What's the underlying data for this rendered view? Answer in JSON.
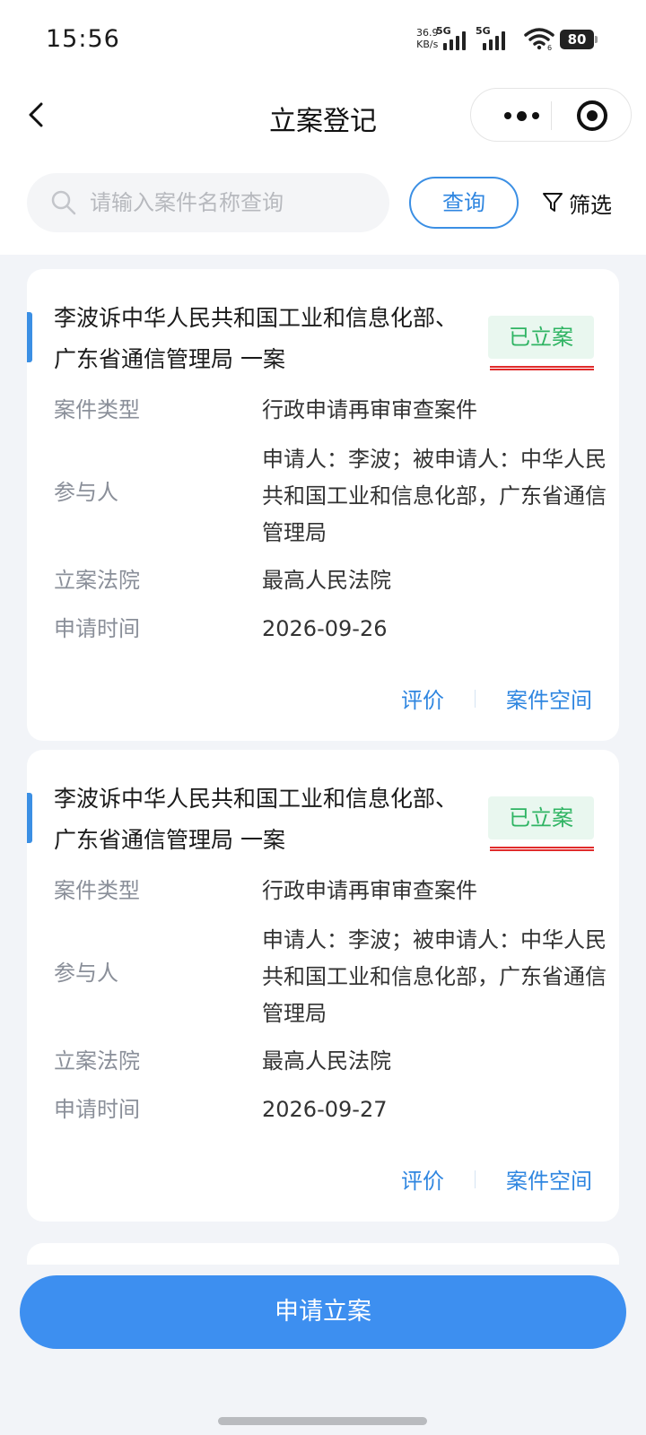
{
  "status_bar": {
    "time": "15:56",
    "net_speed_value": "36.9",
    "net_speed_unit": "KB/s",
    "sim1": "5G",
    "sim2": "5G",
    "wifi_sub": "6",
    "battery": "80"
  },
  "header": {
    "title": "立案登记"
  },
  "search": {
    "placeholder": "请输入案件名称查询",
    "value": "",
    "query_label": "查询",
    "filter_label": "筛选"
  },
  "cases": [
    {
      "title": "李波诉中华人民共和国工业和信息化部、广东省通信管理局 一案",
      "status": "已立案",
      "fields": [
        {
          "label": "案件类型",
          "value": "行政申请再审审查案件"
        },
        {
          "label": "参与人",
          "value": "申请人：李波；被申请人：中华人民共和国工业和信息化部，广东省通信管理局"
        },
        {
          "label": "立案法院",
          "value": "最高人民法院"
        },
        {
          "label": "申请时间",
          "value": "2026-09-26"
        }
      ],
      "action_rate": "评价",
      "action_space": "案件空间"
    },
    {
      "title": "李波诉中华人民共和国工业和信息化部、广东省通信管理局 一案",
      "status": "已立案",
      "fields": [
        {
          "label": "案件类型",
          "value": "行政申请再审审查案件"
        },
        {
          "label": "参与人",
          "value": "申请人：李波；被申请人：中华人民共和国工业和信息化部，广东省通信管理局"
        },
        {
          "label": "立案法院",
          "value": "最高人民法院"
        },
        {
          "label": "申请时间",
          "value": "2026-09-27"
        }
      ],
      "action_rate": "评价",
      "action_space": "案件空间"
    }
  ],
  "bottom": {
    "apply_label": "申请立案"
  },
  "colors": {
    "accent": "#3b8fe4",
    "status_green": "#2fb463",
    "status_bg": "#e9f7ef",
    "underline_red": "#e02b2b"
  }
}
